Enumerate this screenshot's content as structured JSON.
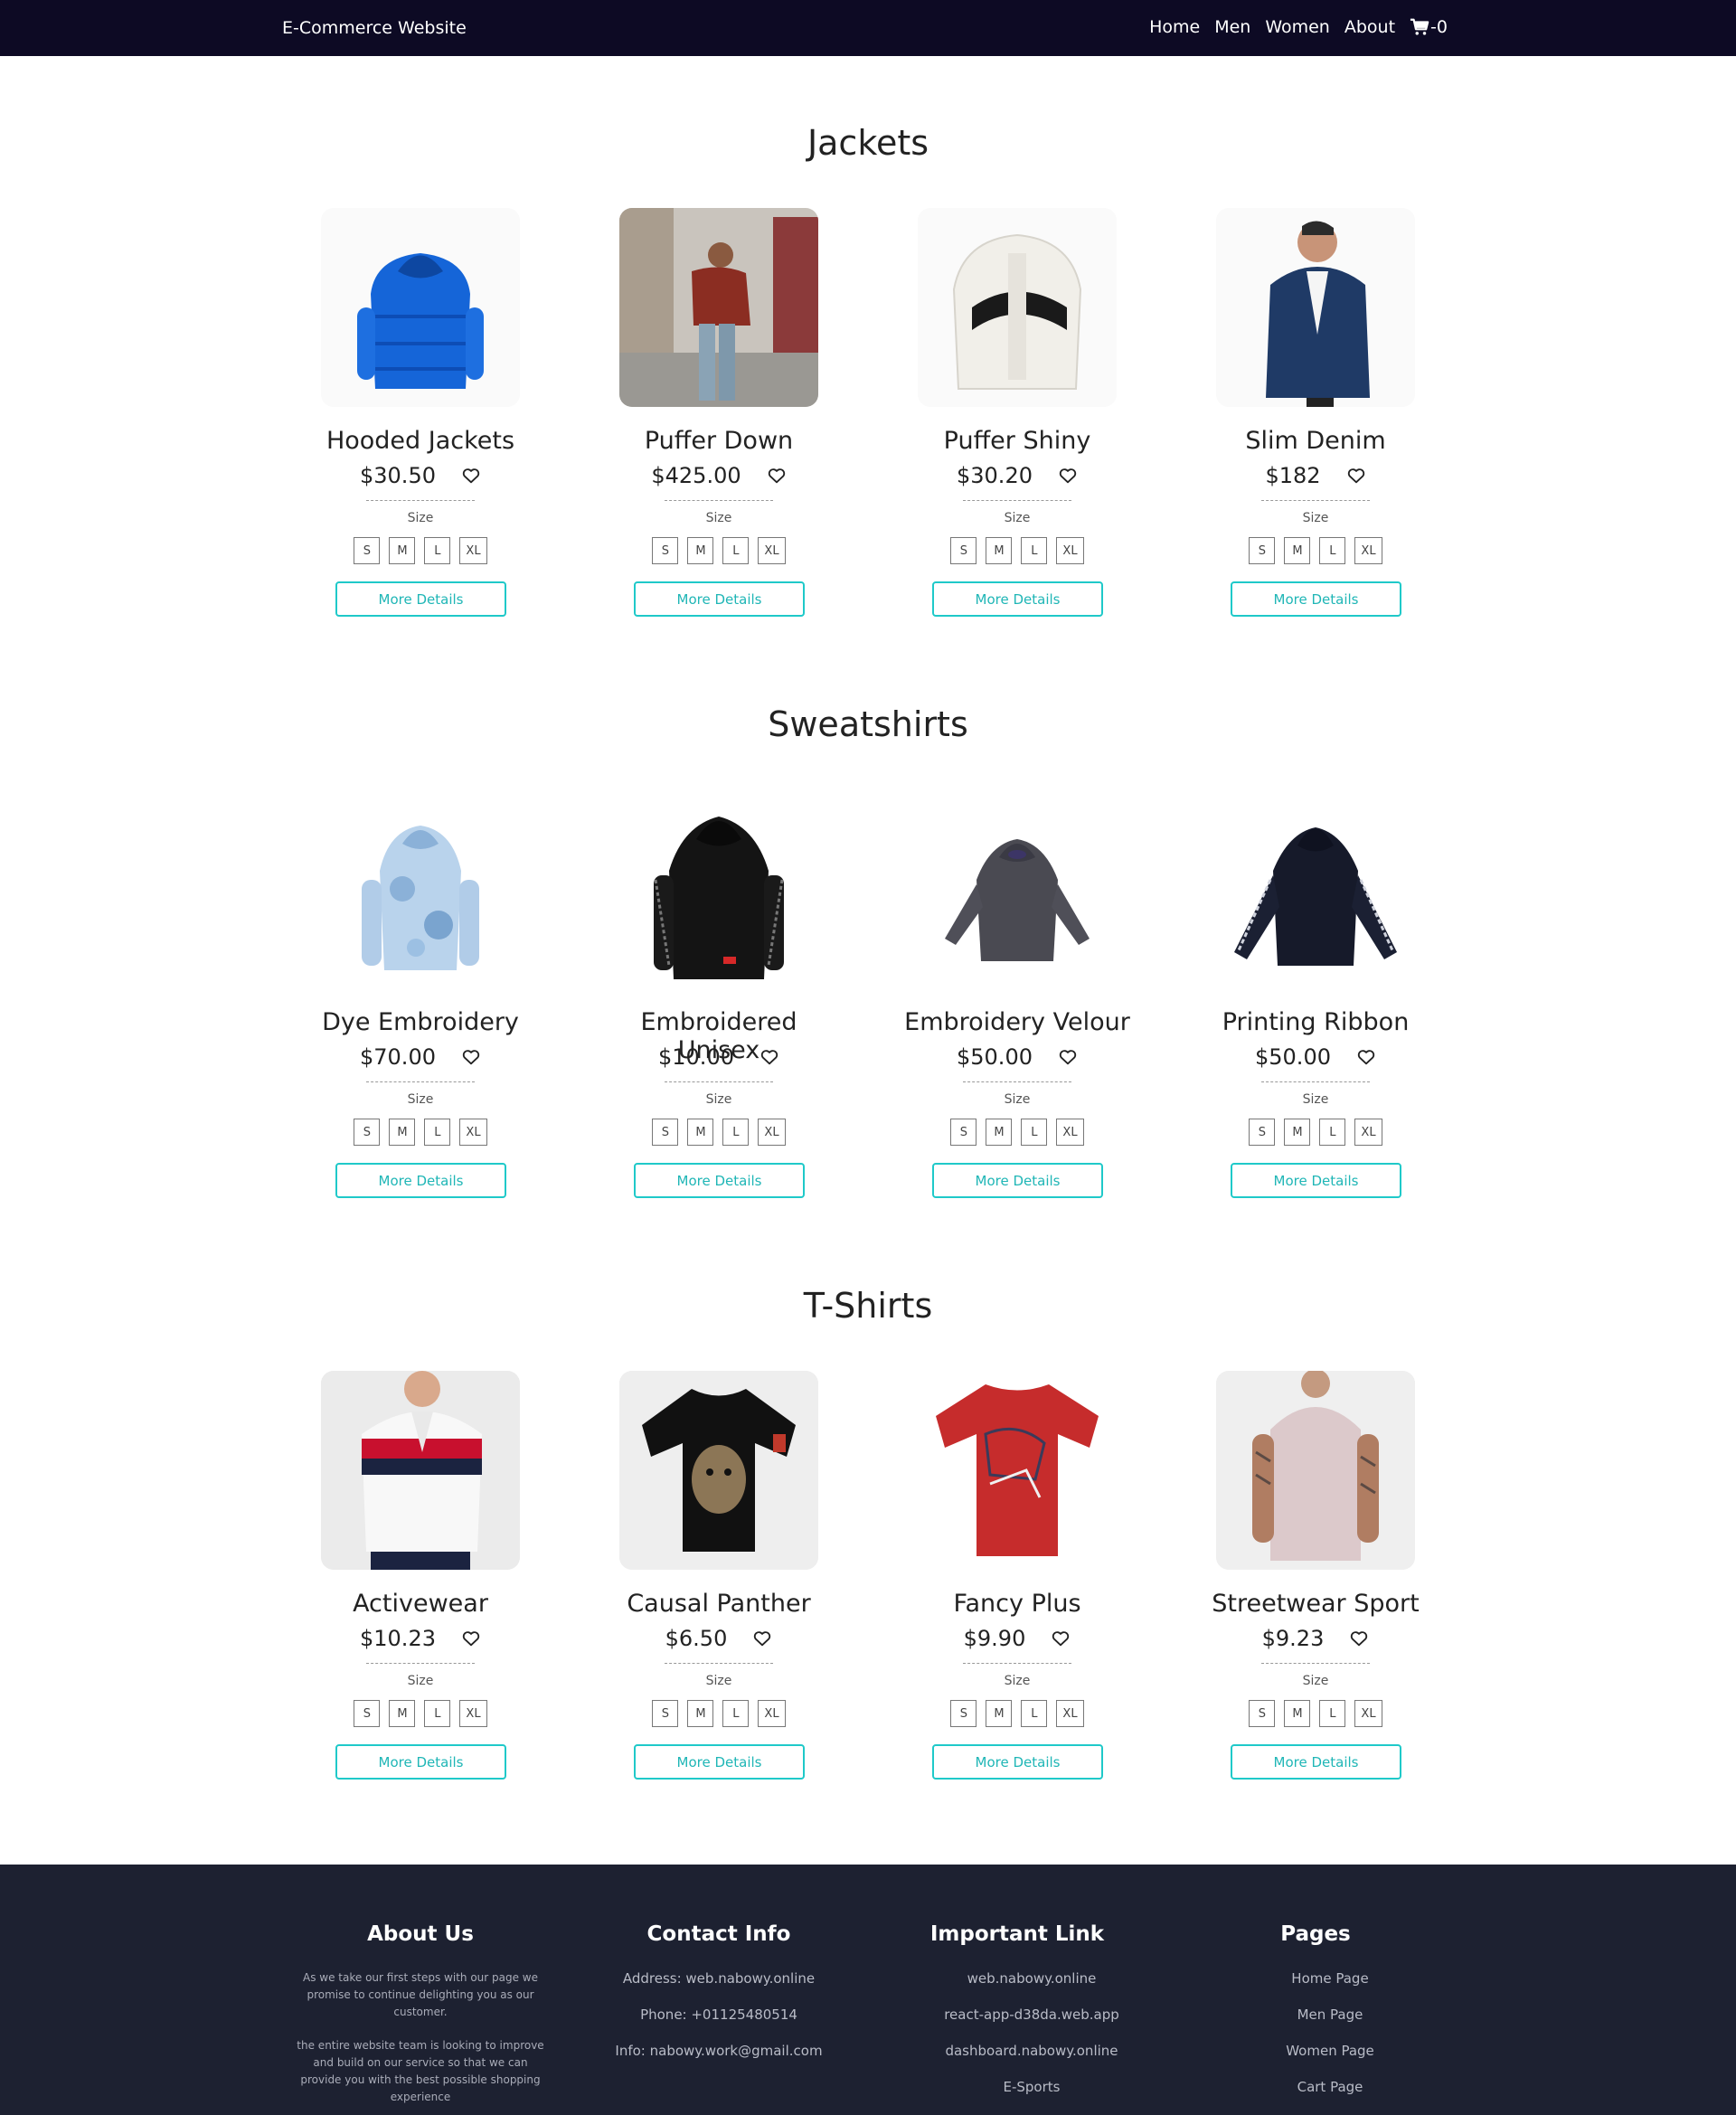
{
  "navbar": {
    "brand": "E-Commerce Website",
    "links": [
      "Home",
      "Men",
      "Women",
      "About"
    ],
    "cart_count": "-0"
  },
  "labels": {
    "size": "Size",
    "sizes": [
      "S",
      "M",
      "L",
      "XL"
    ],
    "more_details": "More Details"
  },
  "sections": [
    {
      "title": "Jackets",
      "products": [
        {
          "name": "Hooded Jackets",
          "price": "$30.50",
          "image": "blue-puffer-jacket"
        },
        {
          "name": "Puffer Down",
          "price": "$425.00",
          "image": "man-in-puffer-down-jacket"
        },
        {
          "name": "Puffer Shiny",
          "price": "$30.20",
          "image": "white-puffer-jacket"
        },
        {
          "name": "Slim Denim",
          "price": "$182",
          "image": "man-in-denim-jacket"
        }
      ]
    },
    {
      "title": "Sweatshirts",
      "products": [
        {
          "name": "Dye Embroidery",
          "price": "$70.00",
          "image": "tie-dye-hoodie"
        },
        {
          "name": "Embroidered Unisex",
          "price": "$10.00",
          "image": "black-hoodie"
        },
        {
          "name": "Embroidery Velour",
          "price": "$50.00",
          "image": "grey-velour-hoodie"
        },
        {
          "name": "Printing Ribbon",
          "price": "$50.00",
          "image": "navy-ribbon-hoodie"
        }
      ]
    },
    {
      "title": "T-Shirts",
      "products": [
        {
          "name": "Activewear",
          "price": "$10.23",
          "image": "striped-polo-shirt"
        },
        {
          "name": "Causal Panther",
          "price": "$6.50",
          "image": "black-panther-tshirt"
        },
        {
          "name": "Fancy Plus",
          "price": "$9.90",
          "image": "red-printed-tshirt"
        },
        {
          "name": "Streetwear Sport",
          "price": "$9.23",
          "image": "man-in-pink-tshirt"
        }
      ]
    }
  ],
  "footer": {
    "about": {
      "title": "About Us",
      "text1": "As we take our first steps with our page we promise to continue delighting you as our customer.",
      "text2": "the entire website team is looking to improve and build on our service so that we can provide you with the best possible shopping experience"
    },
    "contact": {
      "title": "Contact Info",
      "items": [
        "Address: web.nabowy.online",
        "Phone: +01125480514",
        "Info: nabowy.work@gmail.com"
      ]
    },
    "links": {
      "title": "Important Link",
      "items": [
        "web.nabowy.online",
        "react-app-d38da.web.app",
        "dashboard.nabowy.online",
        "E-Sports"
      ]
    },
    "pages": {
      "title": "Pages",
      "items": [
        "Home Page",
        "Men Page",
        "Women Page",
        "Cart Page"
      ]
    }
  },
  "colors": {
    "navbar_bg": "#0d0a24",
    "footer_bg": "#1d2131",
    "accent": "#1fc9c9"
  }
}
